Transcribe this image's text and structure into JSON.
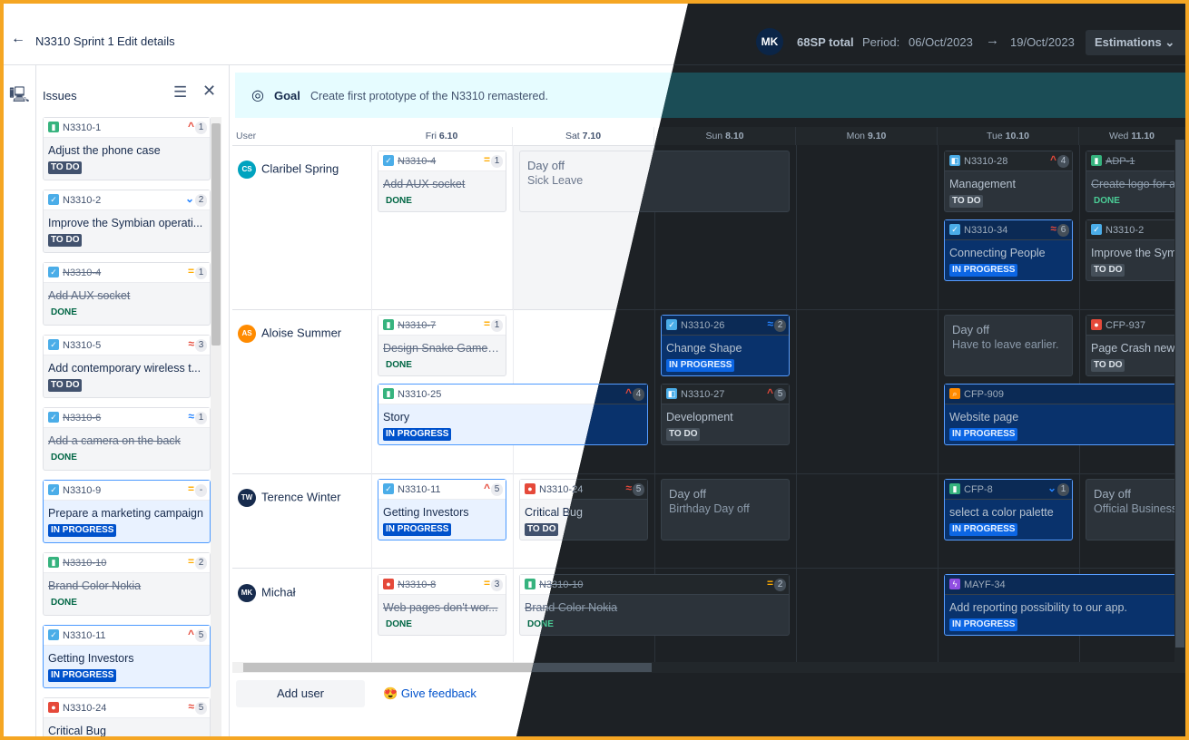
{
  "header": {
    "back_icon": "←",
    "sprint_name": "N3310 Sprint 1",
    "edit_label": "Edit details",
    "user_initials": "MK",
    "sp_total": "68SP total",
    "period_label": "Period:",
    "period_start": "06/Oct/2023",
    "arrow": "→",
    "period_end": "19/Oct/2023",
    "estimations_label": "Estimations",
    "estimations_chevron": "⌄"
  },
  "sidebar": {
    "rail_icon": "🖳",
    "title": "Issues",
    "filter_icon": "☰",
    "close_icon": "✕",
    "issues": [
      {
        "key": "N3310-1",
        "summary": "Adjust the phone case",
        "status": "TO DO",
        "prio": "^",
        "points": "1"
      },
      {
        "key": "N3310-2",
        "summary": "Improve the Symbian operati...",
        "status": "TO DO",
        "prio": "⌄",
        "points": "2"
      },
      {
        "key": "N3310-4",
        "summary": "Add AUX socket",
        "status": "DONE",
        "prio": "=",
        "points": "1"
      },
      {
        "key": "N3310-5",
        "summary": "Add contemporary wireless t...",
        "status": "TO DO",
        "prio": "≈",
        "points": "3"
      },
      {
        "key": "N3310-6",
        "summary": "Add a camera on the back",
        "status": "DONE",
        "prio": "≈",
        "points": "1"
      },
      {
        "key": "N3310-9",
        "summary": "Prepare a marketing campaign",
        "status": "IN PROGRESS",
        "prio": "=",
        "points": "-"
      },
      {
        "key": "N3310-10",
        "summary": "Brand Color Nokia",
        "status": "DONE",
        "prio": "=",
        "points": "2"
      },
      {
        "key": "N3310-11",
        "summary": "Getting Investors",
        "status": "IN PROGRESS",
        "prio": "^",
        "points": "5"
      },
      {
        "key": "N3310-24",
        "summary": "Critical Bug",
        "status": "",
        "prio": "≈",
        "points": "5"
      }
    ]
  },
  "goal": {
    "icon": "◎",
    "label": "Goal",
    "text": "Create first prototype of the N3310 remastered."
  },
  "columns": {
    "user": "User",
    "days": [
      {
        "name": "Fri",
        "date": "6.10"
      },
      {
        "name": "Sat",
        "date": "7.10"
      },
      {
        "name": "Sun",
        "date": "8.10"
      },
      {
        "name": "Mon",
        "date": "9.10"
      },
      {
        "name": "Tue",
        "date": "10.10"
      },
      {
        "name": "Wed",
        "date": "11.10"
      }
    ]
  },
  "users": [
    {
      "initials": "CS",
      "name": "Claribel Spring",
      "color": "#00a3bf"
    },
    {
      "initials": "AS",
      "name": "Aloise Summer",
      "color": "#ff8b00"
    },
    {
      "initials": "TW",
      "name": "Terence Winter",
      "color": "#172b4d"
    },
    {
      "initials": "MK",
      "name": "Michał",
      "color": "#172b4d"
    }
  ],
  "board_cards": {
    "c1": {
      "key": "N3310-4",
      "summary": "Add AUX socket",
      "status": "DONE",
      "prio": "=",
      "points": "1"
    },
    "c2": {
      "key": "N3310-28",
      "summary": "Management",
      "status": "TO DO",
      "prio": "^",
      "points": "4"
    },
    "c3": {
      "key": "ADP-1",
      "summary": "Create logo for a",
      "status": "DONE"
    },
    "c4": {
      "key": "N3310-34",
      "summary": "Connecting People",
      "status": "IN PROGRESS",
      "prio": "≈",
      "points": "6"
    },
    "c5": {
      "key": "N3310-2",
      "summary": "Improve the Sym",
      "status": "TO DO"
    },
    "c6": {
      "key": "N3310-7",
      "summary": "Design Snake Game o...",
      "status": "DONE",
      "prio": "=",
      "points": "1"
    },
    "c7": {
      "key": "N3310-26",
      "summary": "Change Shape",
      "status": "IN PROGRESS",
      "prio": "≈",
      "points": "2"
    },
    "c8": {
      "key": "CFP-937",
      "summary": "Page Crash new",
      "status": "TO DO"
    },
    "c9": {
      "key": "N3310-25",
      "summary": "Story",
      "status": "IN PROGRESS",
      "prio": "^",
      "points": "4"
    },
    "c10": {
      "key": "N3310-27",
      "summary": "Development",
      "status": "TO DO",
      "prio": "^",
      "points": "5"
    },
    "c11": {
      "key": "CFP-909",
      "summary": "Website page",
      "status": "IN PROGRESS"
    },
    "c12": {
      "key": "N3310-11",
      "summary": "Getting Investors",
      "status": "IN PROGRESS",
      "prio": "^",
      "points": "5"
    },
    "c13": {
      "key": "N3310-24",
      "summary": "Critical Bug",
      "status": "TO DO",
      "prio": "≈",
      "points": "5"
    },
    "c14": {
      "key": "CFP-8",
      "summary": "select a color palette",
      "status": "IN PROGRESS",
      "prio": "⌄",
      "points": "1"
    },
    "c15": {
      "key": "N3310-8",
      "summary": "Web pages don't wor...",
      "status": "DONE",
      "prio": "=",
      "points": "3"
    },
    "c16": {
      "key": "N3310-10",
      "summary": "Brand Color Nokia",
      "status": "DONE",
      "prio": "=",
      "points": "2"
    },
    "c17": {
      "key": "MAYF-34",
      "summary": "Add reporting possibility to our app.",
      "status": "IN PROGRESS"
    }
  },
  "dayoffs": {
    "d1": {
      "title": "Day off",
      "desc": "Sick Leave"
    },
    "d2": {
      "title": "Day off",
      "desc": "Have to leave earlier."
    },
    "d3": {
      "title": "Day off",
      "desc": "Birthday Day off"
    },
    "d4": {
      "title": "Day off",
      "desc": "Official Business"
    }
  },
  "footer": {
    "add_user": "Add user",
    "feedback_icon": "😍",
    "feedback": "Give feedback"
  }
}
